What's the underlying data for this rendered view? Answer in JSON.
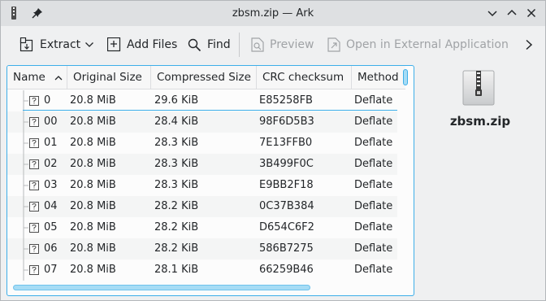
{
  "window": {
    "title": "zbsm.zip — Ark"
  },
  "toolbar": {
    "extract_label": "Extract",
    "add_files_label": "Add Files",
    "find_label": "Find",
    "preview_label": "Preview",
    "open_external_label": "Open in External Application"
  },
  "columns": {
    "name": "Name",
    "original_size": "Original Size",
    "compressed_size": "Compressed Size",
    "crc": "CRC checksum",
    "method": "Method"
  },
  "rows": [
    {
      "name": "0",
      "original_size": "20.8 MiB",
      "compressed_size": "29.6 KiB",
      "crc": "E85258FB",
      "method": "Deflate"
    },
    {
      "name": "00",
      "original_size": "20.8 MiB",
      "compressed_size": "28.4 KiB",
      "crc": "98F6D5B3",
      "method": "Deflate"
    },
    {
      "name": "01",
      "original_size": "20.8 MiB",
      "compressed_size": "28.3 KiB",
      "crc": "7E13FFB0",
      "method": "Deflate"
    },
    {
      "name": "02",
      "original_size": "20.8 MiB",
      "compressed_size": "28.3 KiB",
      "crc": "3B499F0C",
      "method": "Deflate"
    },
    {
      "name": "03",
      "original_size": "20.8 MiB",
      "compressed_size": "28.3 KiB",
      "crc": "E9BB2F18",
      "method": "Deflate"
    },
    {
      "name": "04",
      "original_size": "20.8 MiB",
      "compressed_size": "28.2 KiB",
      "crc": "0C37B384",
      "method": "Deflate"
    },
    {
      "name": "05",
      "original_size": "20.8 MiB",
      "compressed_size": "28.2 KiB",
      "crc": "D654C6F2",
      "method": "Deflate"
    },
    {
      "name": "06",
      "original_size": "20.8 MiB",
      "compressed_size": "28.2 KiB",
      "crc": "586B7275",
      "method": "Deflate"
    },
    {
      "name": "07",
      "original_size": "20.8 MiB",
      "compressed_size": "28.1 KiB",
      "crc": "66259B46",
      "method": "Deflate"
    }
  ],
  "info_panel": {
    "file_name": "zbsm.zip"
  },
  "colors": {
    "accent": "#3daee9",
    "accent_fill": "#a6dcf5",
    "window_bg": "#eff0f1",
    "text": "#232629",
    "disabled_text": "#a0a3a6"
  },
  "icons": [
    "ark-app-icon",
    "pin-icon",
    "chevron-down-icon",
    "chevron-up-icon",
    "close-icon",
    "extract-icon",
    "dropdown-arrow-icon",
    "add-files-icon",
    "search-icon",
    "preview-icon",
    "open-external-icon",
    "more-icon",
    "sort-ascending-icon",
    "unknown-file-icon",
    "zip-archive-icon"
  ]
}
